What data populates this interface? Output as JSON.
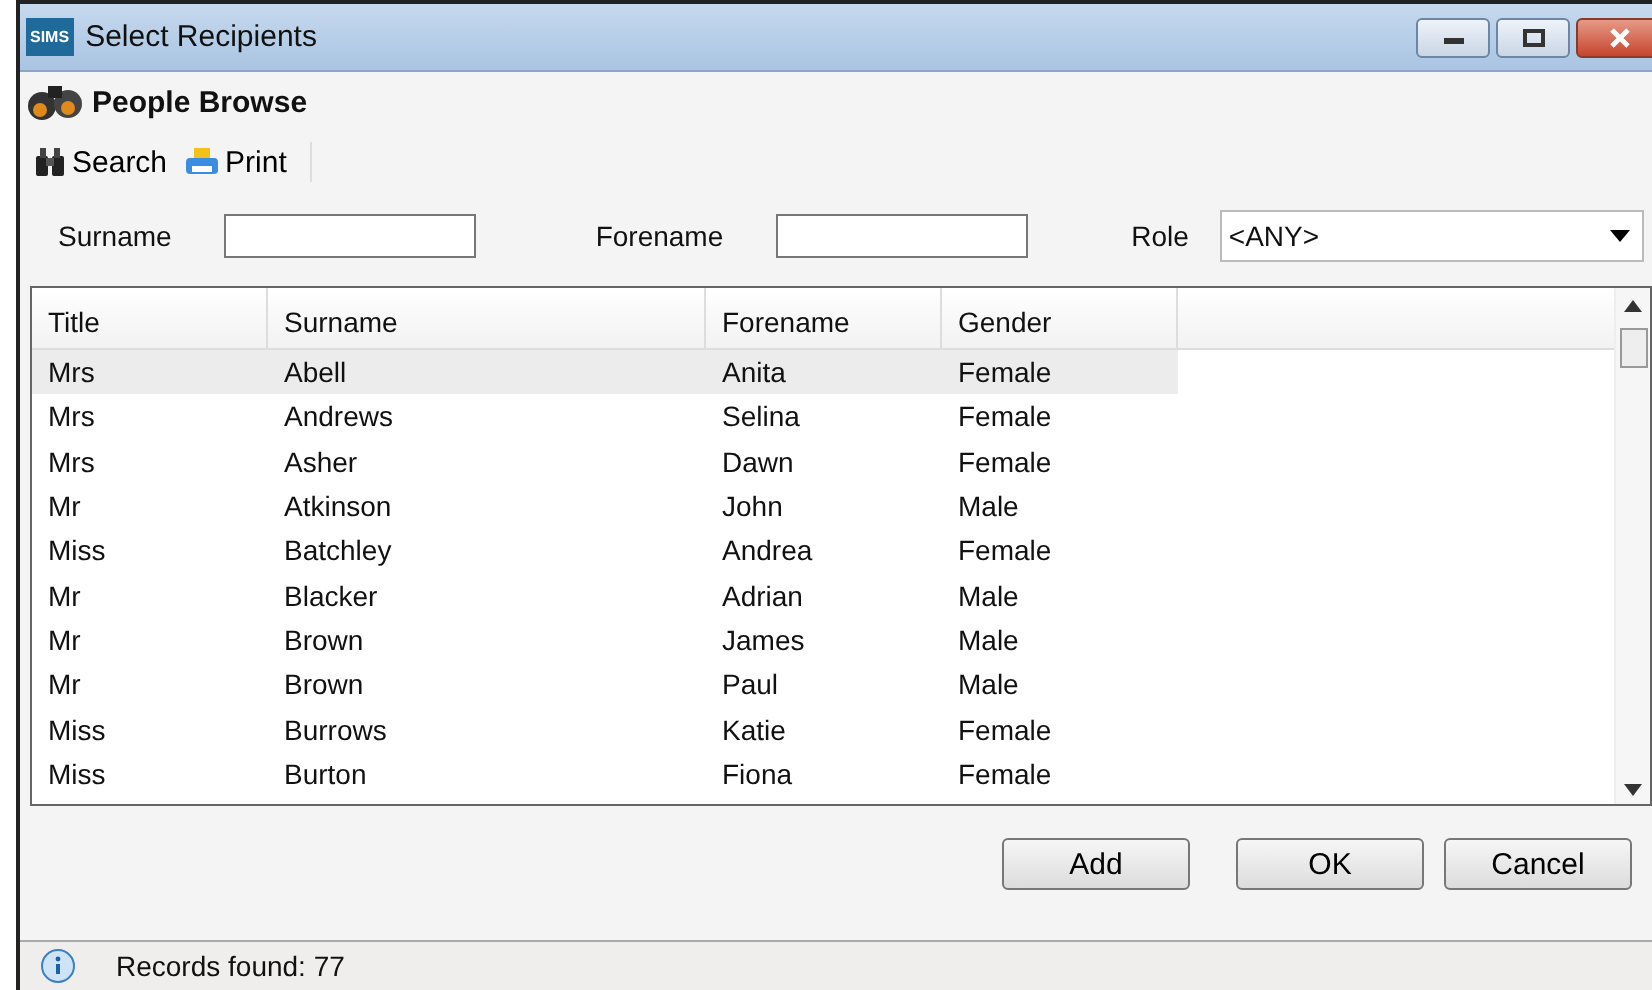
{
  "window": {
    "title": "Select Recipients",
    "app_badge": "SIMS"
  },
  "header": {
    "title": "People Browse"
  },
  "toolbar": [
    "Search",
    "Print"
  ],
  "filters": {
    "surname": {
      "label": "Surname"
    },
    "forename": {
      "label": "Forename"
    },
    "role": {
      "label": "Role",
      "value": "<ANY>"
    }
  },
  "table": {
    "columns": [
      "Title",
      "Surname",
      "Forename",
      "Gender"
    ],
    "rows": [
      {
        "cells": [
          "Mrs",
          "Abell",
          "Anita",
          "Female"
        ],
        "selected": true
      },
      {
        "cells": [
          "Mrs",
          "Andrews",
          "Selina",
          "Female"
        ],
        "selected": false
      },
      {
        "cells": [
          "Mrs",
          "Asher",
          "Dawn",
          "Female"
        ],
        "selected": false
      },
      {
        "cells": [
          "Mr",
          "Atkinson",
          "John",
          "Male"
        ],
        "selected": false
      },
      {
        "cells": [
          "Miss",
          "Batchley",
          "Andrea",
          "Female"
        ],
        "selected": false
      },
      {
        "cells": [
          "Mr",
          "Blacker",
          "Adrian",
          "Male"
        ],
        "selected": false
      },
      {
        "cells": [
          "Mr",
          "Brown",
          "James",
          "Male"
        ],
        "selected": false
      },
      {
        "cells": [
          "Mr",
          "Brown",
          "Paul",
          "Male"
        ],
        "selected": false
      },
      {
        "cells": [
          "Miss",
          "Burrows",
          "Katie",
          "Female"
        ],
        "selected": false
      },
      {
        "cells": [
          "Miss",
          "Burton",
          "Fiona",
          "Female"
        ],
        "selected": false
      }
    ]
  },
  "buttons": [
    "Add",
    "OK",
    "Cancel"
  ],
  "status_bar": "Records found: 77"
}
